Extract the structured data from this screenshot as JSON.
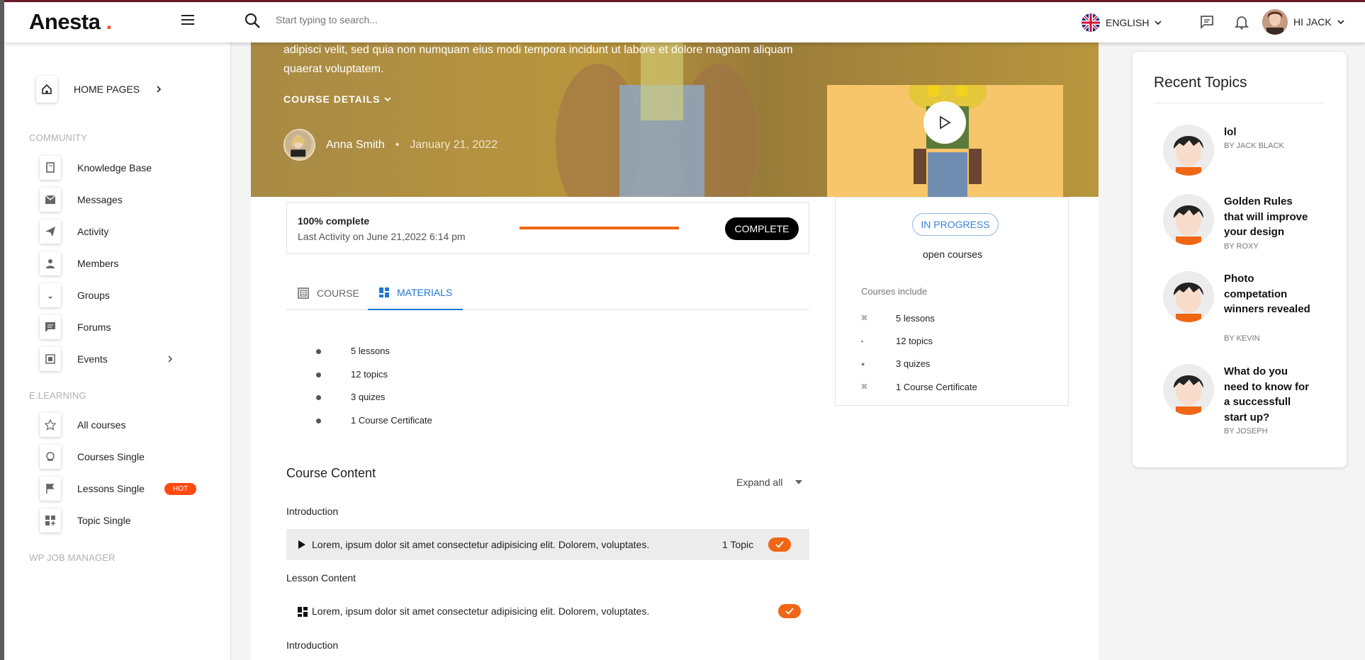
{
  "header": {
    "logo": "Anesta",
    "logo_dot": ".",
    "search_placeholder": "Start typing to search...",
    "language": "ENGLISH",
    "user": "HI JACK"
  },
  "sidebar": {
    "home": "HOME PAGES",
    "sections": {
      "community": "COMMUNITY",
      "elearning": "E.LEARNING",
      "wpjob": "WP JOB MANAGER"
    },
    "community_items": [
      "Knowledge Base",
      "Messages",
      "Activity",
      "Members",
      "Groups",
      "Forums",
      "Events"
    ],
    "elearning_items": [
      "All courses",
      "Courses Single",
      "Lessons Single",
      "Topic Single"
    ],
    "hot_badge": "HOT"
  },
  "hero": {
    "text": "adipisci velit, sed quia non numquam eius modi tempora incidunt ut labore et dolore magnam aliquam quaerat voluptatem.",
    "course_details": "COURSE DETAILS",
    "author": "Anna Smith",
    "separator": "•",
    "date": "January 21, 2022"
  },
  "progress": {
    "title": "100% complete",
    "last_activity": "Last Activity on June 21,2022 6:14 pm",
    "value": 1.0,
    "button": "COMPLETE"
  },
  "tabs": {
    "course": "COURSE",
    "materials": "MATERIALS"
  },
  "materials": [
    "5 lessons",
    "12 topics",
    "3 quizes",
    "1 Course Certificate"
  ],
  "course_content": {
    "title": "Course Content",
    "expand": "Expand all",
    "section1": "Introduction",
    "lesson1": "Lorem, ipsum dolor sit amet consectetur adipisicing elit. Dolorem, voluptates.",
    "lesson1_count": "1 Topic",
    "section2": "Lesson Content",
    "lesson2": "Lorem, ipsum dolor sit amet consectetur adipisicing elit. Dolorem, voluptates.",
    "section3": "Introduction"
  },
  "side_card": {
    "status": "IN PROGRESS",
    "open": "open courses",
    "includes_label": "Courses include",
    "items": [
      "5 lessons",
      "12 topics",
      "3 quizes",
      "1 Course Certificate"
    ]
  },
  "recent_topics": {
    "title": "Recent Topics",
    "items": [
      {
        "title": "lol",
        "by": "BY JACK BLACK"
      },
      {
        "title": "Golden Rules that will improve your design",
        "by": "BY ROXY"
      },
      {
        "title": "Photo competation winners revealed",
        "by": "BY KEVIN"
      },
      {
        "title": "What do you need to know for a successfull start up?",
        "by": "BY JOSEPH"
      }
    ]
  },
  "colors": {
    "accent": "#f06614",
    "link": "#1e77d3",
    "hot": "#ff4a12"
  }
}
